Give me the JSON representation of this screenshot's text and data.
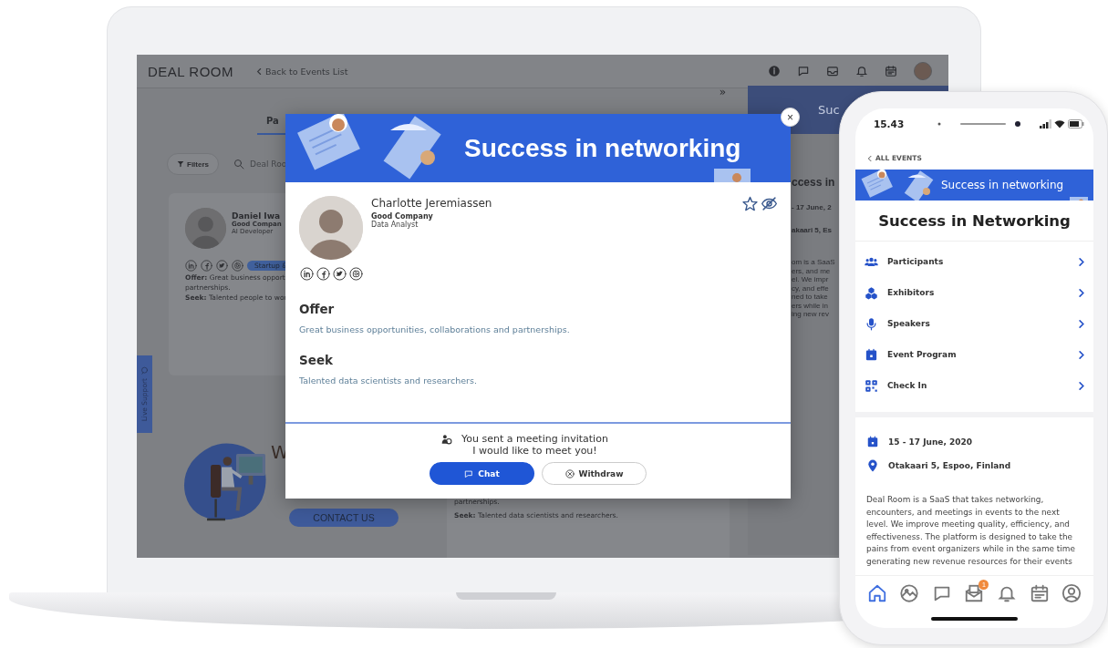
{
  "laptop": {
    "app": {
      "logo": "DEAL ROOM",
      "back_link": "Back to Events List",
      "tab": {
        "label": "Pa",
        "selected": true
      },
      "filters_button": "Filters",
      "search": {
        "placeholder": "Deal Roo"
      },
      "participant_card": {
        "name": "Daniel Iwa",
        "company": "Good Compan",
        "role": "AI Developer",
        "tag": "Startup &",
        "lines": [
          "**Offer:** Great business opport",
          "partnerships.",
          "**Seek:** Talented people to wor"
        ]
      },
      "live_support": "Live Support",
      "promo_heading": "W",
      "contact_button": "CONTACT US",
      "collapse_button": "»",
      "second_card_lines": [
        "partnerships.",
        "**Seek:** Talented data scientists and researchers."
      ],
      "event_panel": {
        "banner_text": "Suc",
        "title": "ccess in",
        "date": "- 17 June, 2",
        "location": "akaari 5, Es",
        "description_lines": [
          "om is a SaaS",
          "ers, and me",
          "el. We impr",
          "cy, and effe",
          "ned to take",
          "ers while in",
          "ing new rev"
        ]
      }
    },
    "modal": {
      "banner_title": "Success in networking",
      "close": "×",
      "name": "Charlotte Jeremiassen",
      "company": "Good Company",
      "role": "Data Analyst",
      "favorite": false,
      "sections": [
        {
          "heading": "Offer",
          "text": "Great business opportunities, collaborations and partnerships."
        },
        {
          "heading": "Seek",
          "text": "Talented data scientists and researchers."
        }
      ],
      "status_lines": [
        "You sent a meeting invitation",
        "I would like to meet you!"
      ],
      "buttons": [
        {
          "label": "Chat",
          "kind": "primary"
        },
        {
          "label": "Withdraw",
          "kind": "secondary"
        }
      ]
    }
  },
  "phone": {
    "time": "15.43",
    "back_link": "ALL EVENTS",
    "banner_title": "Success in networking",
    "title": "Success in Networking",
    "menu": [
      {
        "label": "Participants",
        "kind": "participants"
      },
      {
        "label": "Exhibitors",
        "kind": "exhibitors"
      },
      {
        "label": "Speakers",
        "kind": "speakers"
      },
      {
        "label": "Event Program",
        "kind": "program"
      },
      {
        "label": "Check In",
        "kind": "checkin"
      }
    ],
    "date": "15 - 17 June, 2020",
    "location": "Otakaari 5, Espoo, Finland",
    "description": "Deal Room is a SaaS that takes networking, encounters, and meetings in events to the next level. We improve meeting quality, efficiency, and effectiveness. The platform is designed to take the pains from event organizers while in the same time generating new revenue resources for their events",
    "tab_bar": [
      {
        "kind": "home",
        "selected": true
      },
      {
        "kind": "gallery",
        "selected": false
      },
      {
        "kind": "chat",
        "selected": false
      },
      {
        "kind": "mail",
        "selected": false,
        "badge": "1"
      },
      {
        "kind": "bell",
        "selected": false
      },
      {
        "kind": "calendar",
        "selected": false
      },
      {
        "kind": "profile",
        "selected": false
      }
    ]
  }
}
